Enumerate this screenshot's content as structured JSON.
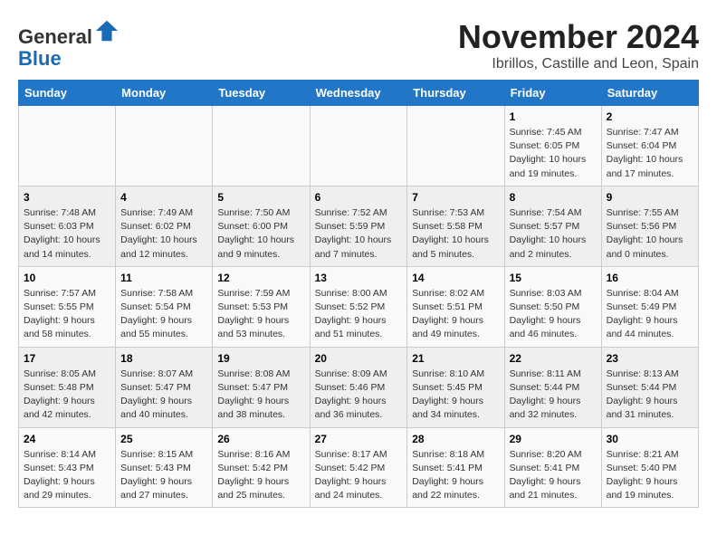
{
  "logo": {
    "line1": "General",
    "line2": "Blue"
  },
  "title": "November 2024",
  "location": "Ibrillos, Castille and Leon, Spain",
  "weekdays": [
    "Sunday",
    "Monday",
    "Tuesday",
    "Wednesday",
    "Thursday",
    "Friday",
    "Saturday"
  ],
  "weeks": [
    [
      {
        "day": "",
        "info": ""
      },
      {
        "day": "",
        "info": ""
      },
      {
        "day": "",
        "info": ""
      },
      {
        "day": "",
        "info": ""
      },
      {
        "day": "",
        "info": ""
      },
      {
        "day": "1",
        "info": "Sunrise: 7:45 AM\nSunset: 6:05 PM\nDaylight: 10 hours and 19 minutes."
      },
      {
        "day": "2",
        "info": "Sunrise: 7:47 AM\nSunset: 6:04 PM\nDaylight: 10 hours and 17 minutes."
      }
    ],
    [
      {
        "day": "3",
        "info": "Sunrise: 7:48 AM\nSunset: 6:03 PM\nDaylight: 10 hours and 14 minutes."
      },
      {
        "day": "4",
        "info": "Sunrise: 7:49 AM\nSunset: 6:02 PM\nDaylight: 10 hours and 12 minutes."
      },
      {
        "day": "5",
        "info": "Sunrise: 7:50 AM\nSunset: 6:00 PM\nDaylight: 10 hours and 9 minutes."
      },
      {
        "day": "6",
        "info": "Sunrise: 7:52 AM\nSunset: 5:59 PM\nDaylight: 10 hours and 7 minutes."
      },
      {
        "day": "7",
        "info": "Sunrise: 7:53 AM\nSunset: 5:58 PM\nDaylight: 10 hours and 5 minutes."
      },
      {
        "day": "8",
        "info": "Sunrise: 7:54 AM\nSunset: 5:57 PM\nDaylight: 10 hours and 2 minutes."
      },
      {
        "day": "9",
        "info": "Sunrise: 7:55 AM\nSunset: 5:56 PM\nDaylight: 10 hours and 0 minutes."
      }
    ],
    [
      {
        "day": "10",
        "info": "Sunrise: 7:57 AM\nSunset: 5:55 PM\nDaylight: 9 hours and 58 minutes."
      },
      {
        "day": "11",
        "info": "Sunrise: 7:58 AM\nSunset: 5:54 PM\nDaylight: 9 hours and 55 minutes."
      },
      {
        "day": "12",
        "info": "Sunrise: 7:59 AM\nSunset: 5:53 PM\nDaylight: 9 hours and 53 minutes."
      },
      {
        "day": "13",
        "info": "Sunrise: 8:00 AM\nSunset: 5:52 PM\nDaylight: 9 hours and 51 minutes."
      },
      {
        "day": "14",
        "info": "Sunrise: 8:02 AM\nSunset: 5:51 PM\nDaylight: 9 hours and 49 minutes."
      },
      {
        "day": "15",
        "info": "Sunrise: 8:03 AM\nSunset: 5:50 PM\nDaylight: 9 hours and 46 minutes."
      },
      {
        "day": "16",
        "info": "Sunrise: 8:04 AM\nSunset: 5:49 PM\nDaylight: 9 hours and 44 minutes."
      }
    ],
    [
      {
        "day": "17",
        "info": "Sunrise: 8:05 AM\nSunset: 5:48 PM\nDaylight: 9 hours and 42 minutes."
      },
      {
        "day": "18",
        "info": "Sunrise: 8:07 AM\nSunset: 5:47 PM\nDaylight: 9 hours and 40 minutes."
      },
      {
        "day": "19",
        "info": "Sunrise: 8:08 AM\nSunset: 5:47 PM\nDaylight: 9 hours and 38 minutes."
      },
      {
        "day": "20",
        "info": "Sunrise: 8:09 AM\nSunset: 5:46 PM\nDaylight: 9 hours and 36 minutes."
      },
      {
        "day": "21",
        "info": "Sunrise: 8:10 AM\nSunset: 5:45 PM\nDaylight: 9 hours and 34 minutes."
      },
      {
        "day": "22",
        "info": "Sunrise: 8:11 AM\nSunset: 5:44 PM\nDaylight: 9 hours and 32 minutes."
      },
      {
        "day": "23",
        "info": "Sunrise: 8:13 AM\nSunset: 5:44 PM\nDaylight: 9 hours and 31 minutes."
      }
    ],
    [
      {
        "day": "24",
        "info": "Sunrise: 8:14 AM\nSunset: 5:43 PM\nDaylight: 9 hours and 29 minutes."
      },
      {
        "day": "25",
        "info": "Sunrise: 8:15 AM\nSunset: 5:43 PM\nDaylight: 9 hours and 27 minutes."
      },
      {
        "day": "26",
        "info": "Sunrise: 8:16 AM\nSunset: 5:42 PM\nDaylight: 9 hours and 25 minutes."
      },
      {
        "day": "27",
        "info": "Sunrise: 8:17 AM\nSunset: 5:42 PM\nDaylight: 9 hours and 24 minutes."
      },
      {
        "day": "28",
        "info": "Sunrise: 8:18 AM\nSunset: 5:41 PM\nDaylight: 9 hours and 22 minutes."
      },
      {
        "day": "29",
        "info": "Sunrise: 8:20 AM\nSunset: 5:41 PM\nDaylight: 9 hours and 21 minutes."
      },
      {
        "day": "30",
        "info": "Sunrise: 8:21 AM\nSunset: 5:40 PM\nDaylight: 9 hours and 19 minutes."
      }
    ]
  ]
}
